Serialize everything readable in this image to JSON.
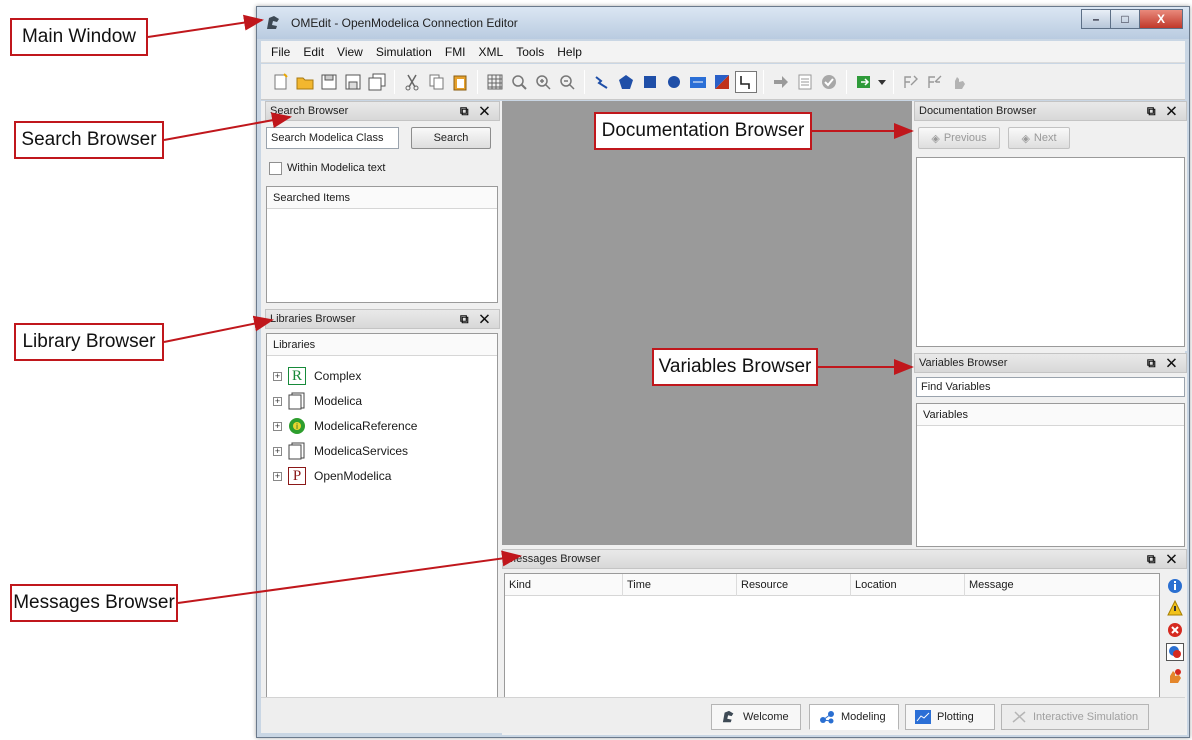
{
  "callouts": {
    "main_window": "Main Window",
    "search_browser": "Search Browser",
    "library_browser": "Library Browser",
    "messages_browser": "Messages Browser",
    "documentation_browser": "Documentation Browser",
    "variables_browser": "Variables Browser"
  },
  "window": {
    "title": "OMEdit - OpenModelica Connection Editor",
    "minimize": "–",
    "maximize": "□",
    "close": "X"
  },
  "menu": [
    "File",
    "Edit",
    "View",
    "Simulation",
    "FMI",
    "XML",
    "Tools",
    "Help"
  ],
  "search_browser": {
    "title": "Search Browser",
    "input_placeholder": "Search Modelica Class",
    "search_button": "Search",
    "within_checkbox": "Within Modelica text",
    "results_header": "Searched Items"
  },
  "libraries_browser": {
    "title": "Libraries Browser",
    "header": "Libraries",
    "items": [
      "Complex",
      "Modelica",
      "ModelicaReference",
      "ModelicaServices",
      "OpenModelica"
    ]
  },
  "documentation_browser": {
    "title": "Documentation Browser",
    "previous": "Previous",
    "next": "Next"
  },
  "variables_browser": {
    "title": "Variables Browser",
    "find_placeholder": "Find Variables",
    "header": "Variables"
  },
  "messages_browser": {
    "title": "Messages Browser",
    "columns": [
      "Kind",
      "Time",
      "Resource",
      "Location",
      "Message"
    ]
  },
  "dock_controls": "⧉ ✕",
  "perspectives": [
    "Welcome",
    "Modeling",
    "Plotting",
    "Interactive Simulation"
  ],
  "colors": {
    "callout_red": "#c0171c",
    "canvas_gray": "#9a9a9a"
  }
}
